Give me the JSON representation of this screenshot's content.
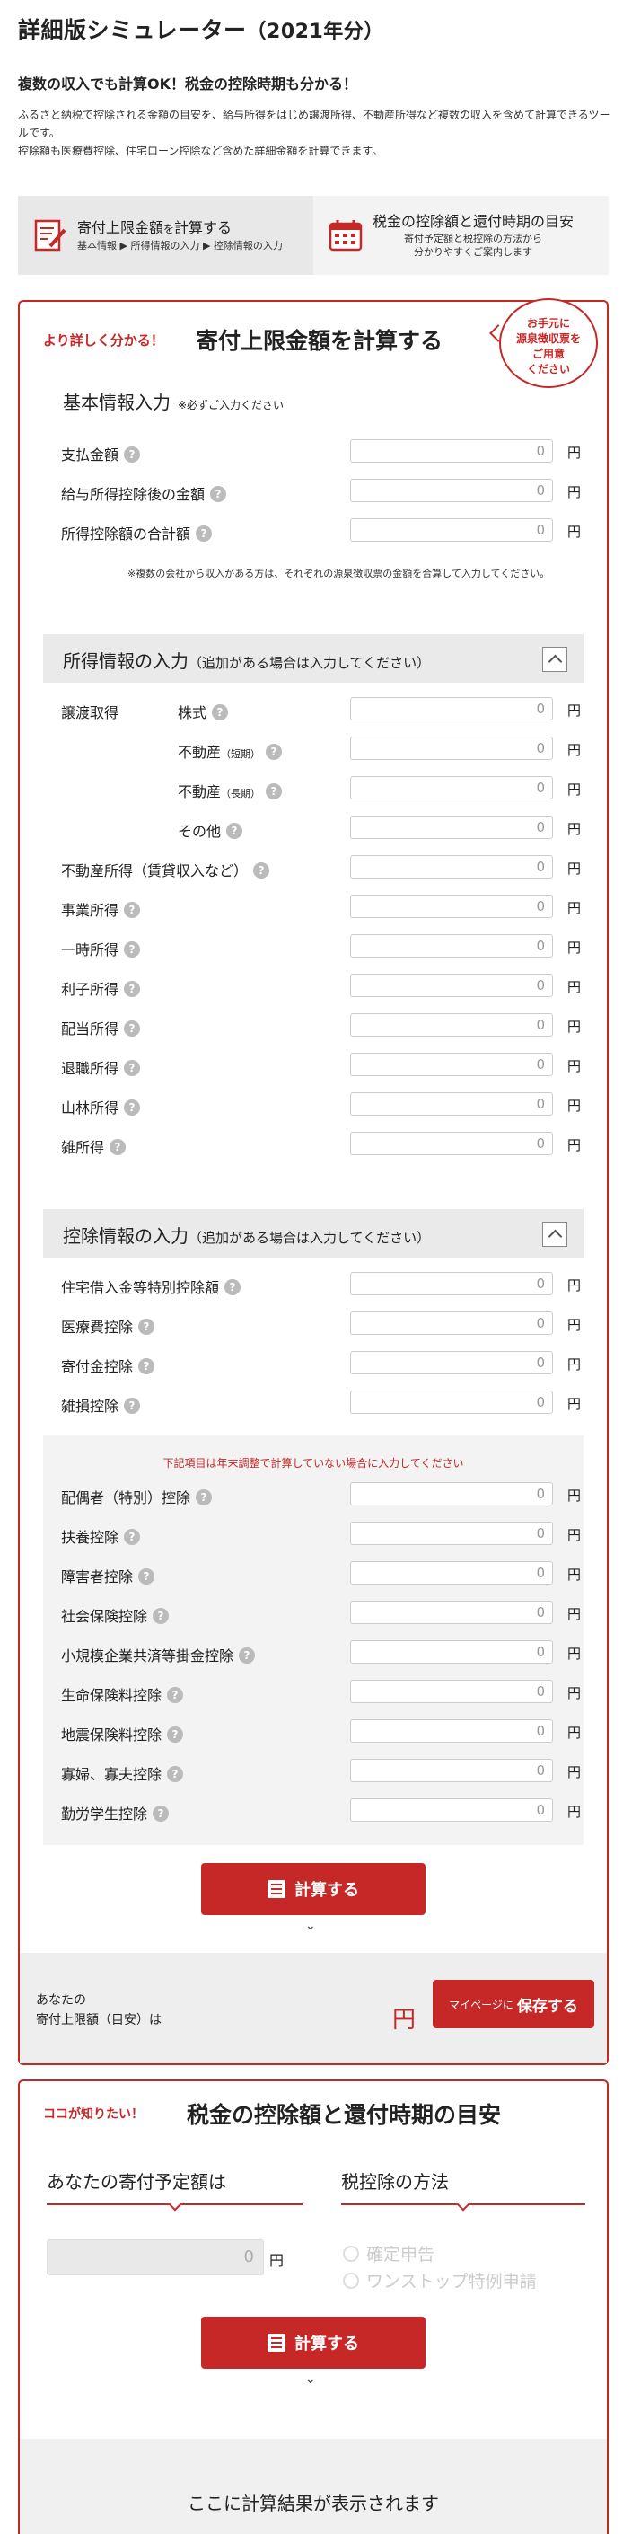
{
  "header": {
    "title": "詳細版シミュレーター",
    "title_sub": "（2021年分）",
    "headline": "複数の収入でも計算OK！税金の控除時期も分かる！",
    "desc1": "ふるさと納税で控除される金額の目安を、給与所得をはじめ譲渡所得、不動産所得など複数の収入を含めて計算できるツールです。",
    "desc2": "控除額も医療費控除、住宅ローン控除など含めた詳細金額を計算できます。"
  },
  "tabs": [
    {
      "title_a": "寄付上限金額",
      "title_b": "を",
      "title_c": "計算する",
      "sub": "基本情報 ▶ 所得情報の入力 ▶ 控除情報の入力",
      "icon": "document-pen-icon"
    },
    {
      "title": "税金の控除額と還付時期の目安",
      "sub1": "寄付予定額と税控除の方法から",
      "sub2": "分かりやすくご案内します",
      "icon": "calendar-icon"
    }
  ],
  "card1": {
    "lead": "より詳しく分かる！",
    "title": "寄付上限金額を計算する",
    "bubble": [
      "お手元に",
      "源泉徴収票を",
      "ご用意",
      "ください"
    ],
    "basic_title": "基本情報入力",
    "basic_note": "※必ずご入力ください",
    "basic_rows": [
      {
        "label": "支払金額",
        "value": "0",
        "unit": "円"
      },
      {
        "label": "給与所得控除後の金額",
        "value": "0",
        "unit": "円"
      },
      {
        "label": "所得控除額の合計額",
        "value": "0",
        "unit": "円"
      }
    ],
    "basic_footnote": "※複数の会社から収入がある方は、それぞれの源泉徴収票の金額を合算して入力してください。",
    "income_title": "所得情報の入力",
    "income_note": "（追加がある場合は入力してください）",
    "transfer_label": "譲渡取得",
    "transfer_rows": [
      {
        "label": "株式",
        "suffix": "",
        "value": "0",
        "unit": "円"
      },
      {
        "label": "不動産",
        "suffix": "（短期）",
        "value": "0",
        "unit": "円"
      },
      {
        "label": "不動産",
        "suffix": "（長期）",
        "value": "0",
        "unit": "円"
      },
      {
        "label": "その他",
        "suffix": "",
        "value": "0",
        "unit": "円"
      }
    ],
    "income_rows": [
      {
        "label": "不動産所得（賃貸収入など）",
        "value": "0",
        "unit": "円"
      },
      {
        "label": "事業所得",
        "value": "0",
        "unit": "円"
      },
      {
        "label": "一時所得",
        "value": "0",
        "unit": "円"
      },
      {
        "label": "利子所得",
        "value": "0",
        "unit": "円"
      },
      {
        "label": "配当所得",
        "value": "0",
        "unit": "円"
      },
      {
        "label": "退職所得",
        "value": "0",
        "unit": "円"
      },
      {
        "label": "山林所得",
        "value": "0",
        "unit": "円"
      },
      {
        "label": "雑所得",
        "value": "0",
        "unit": "円"
      }
    ],
    "deduct_title": "控除情報の入力",
    "deduct_note": "（追加がある場合は入力してください）",
    "deduct_rows": [
      {
        "label": "住宅借入金等特別控除額",
        "value": "0",
        "unit": "円"
      },
      {
        "label": "医療費控除",
        "value": "0",
        "unit": "円"
      },
      {
        "label": "寄付金控除",
        "value": "0",
        "unit": "円"
      },
      {
        "label": "雑損控除",
        "value": "0",
        "unit": "円"
      }
    ],
    "year_end_note": "下記項目は年末調整で計算していない場合に入力してください",
    "year_end_rows": [
      {
        "label": "配偶者（特別）控除",
        "value": "0",
        "unit": "円"
      },
      {
        "label": "扶養控除",
        "value": "0",
        "unit": "円"
      },
      {
        "label": "障害者控除",
        "value": "0",
        "unit": "円"
      },
      {
        "label": "社会保険控除",
        "value": "0",
        "unit": "円"
      },
      {
        "label": "小規模企業共済等掛金控除",
        "value": "0",
        "unit": "円"
      },
      {
        "label": "生命保険料控除",
        "value": "0",
        "unit": "円"
      },
      {
        "label": "地震保険料控除",
        "value": "0",
        "unit": "円"
      },
      {
        "label": "寡婦、寡夫控除",
        "value": "0",
        "unit": "円"
      },
      {
        "label": "勤労学生控除",
        "value": "0",
        "unit": "円"
      }
    ],
    "calc_label": "計算する",
    "result_label1": "あなたの",
    "result_label2": "寄付上限額（目安）は",
    "result_unit": "円",
    "save_small": "マイページに",
    "save_label": "保存する"
  },
  "card2": {
    "hint": "ココが知りたい！",
    "title": "税金の控除額と還付時期の目安",
    "col1": "あなたの寄付予定額は",
    "col2": "税控除の方法",
    "donation_value": "0",
    "donation_unit": "円",
    "methods": [
      "確定申告",
      "ワンストップ特例申請"
    ],
    "calc_label": "計算する",
    "result_text": "ここに計算結果が表示されます"
  },
  "colors": {
    "accent": "#c62828",
    "band": "#eaeaea"
  }
}
